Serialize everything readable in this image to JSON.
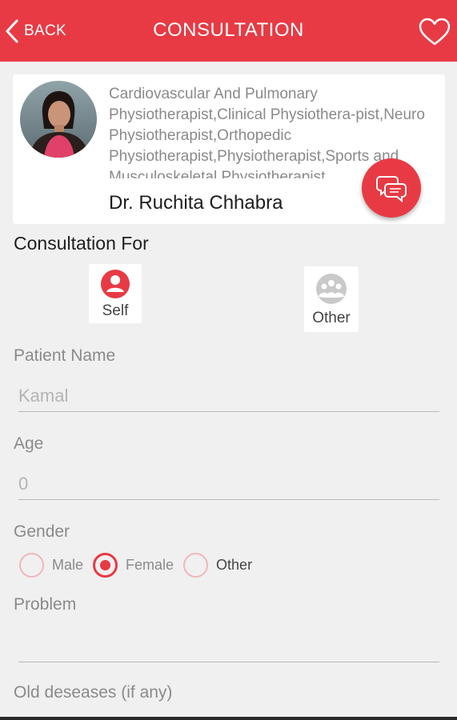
{
  "appbar": {
    "back_label": "BACK",
    "title": "CONSULTATION",
    "favorite_icon": "heart-outline-icon",
    "color": "#e83a44"
  },
  "doctor": {
    "specialties": "Cardiovascular And Pulmonary Physiotherapist,Clinical Physiothera-pist,Neuro Physiotherapist,Orthopedic Physiotherapist,Physiotherapist,Sports and Musculoskeletal Physiotherapist",
    "name": "Dr. Ruchita Chhabra",
    "chat_icon": "chat-bubbles-icon"
  },
  "consultation_for": {
    "label": "Consultation For",
    "options": [
      {
        "label": "Self",
        "icon": "person-icon",
        "selected": true
      },
      {
        "label": "Other",
        "icon": "group-icon",
        "selected": false
      }
    ]
  },
  "form": {
    "patient_name": {
      "label": "Patient Name",
      "placeholder": "Kamal"
    },
    "age": {
      "label": "Age",
      "placeholder": "0"
    },
    "gender": {
      "label": "Gender",
      "options": [
        {
          "label": "Male",
          "checked": false
        },
        {
          "label": "Female",
          "checked": true
        },
        {
          "label": "Other",
          "checked": false
        }
      ]
    },
    "problem": {
      "label": "Problem",
      "value": ""
    },
    "old_diseases": {
      "label": "Old deseases (if any)"
    }
  }
}
